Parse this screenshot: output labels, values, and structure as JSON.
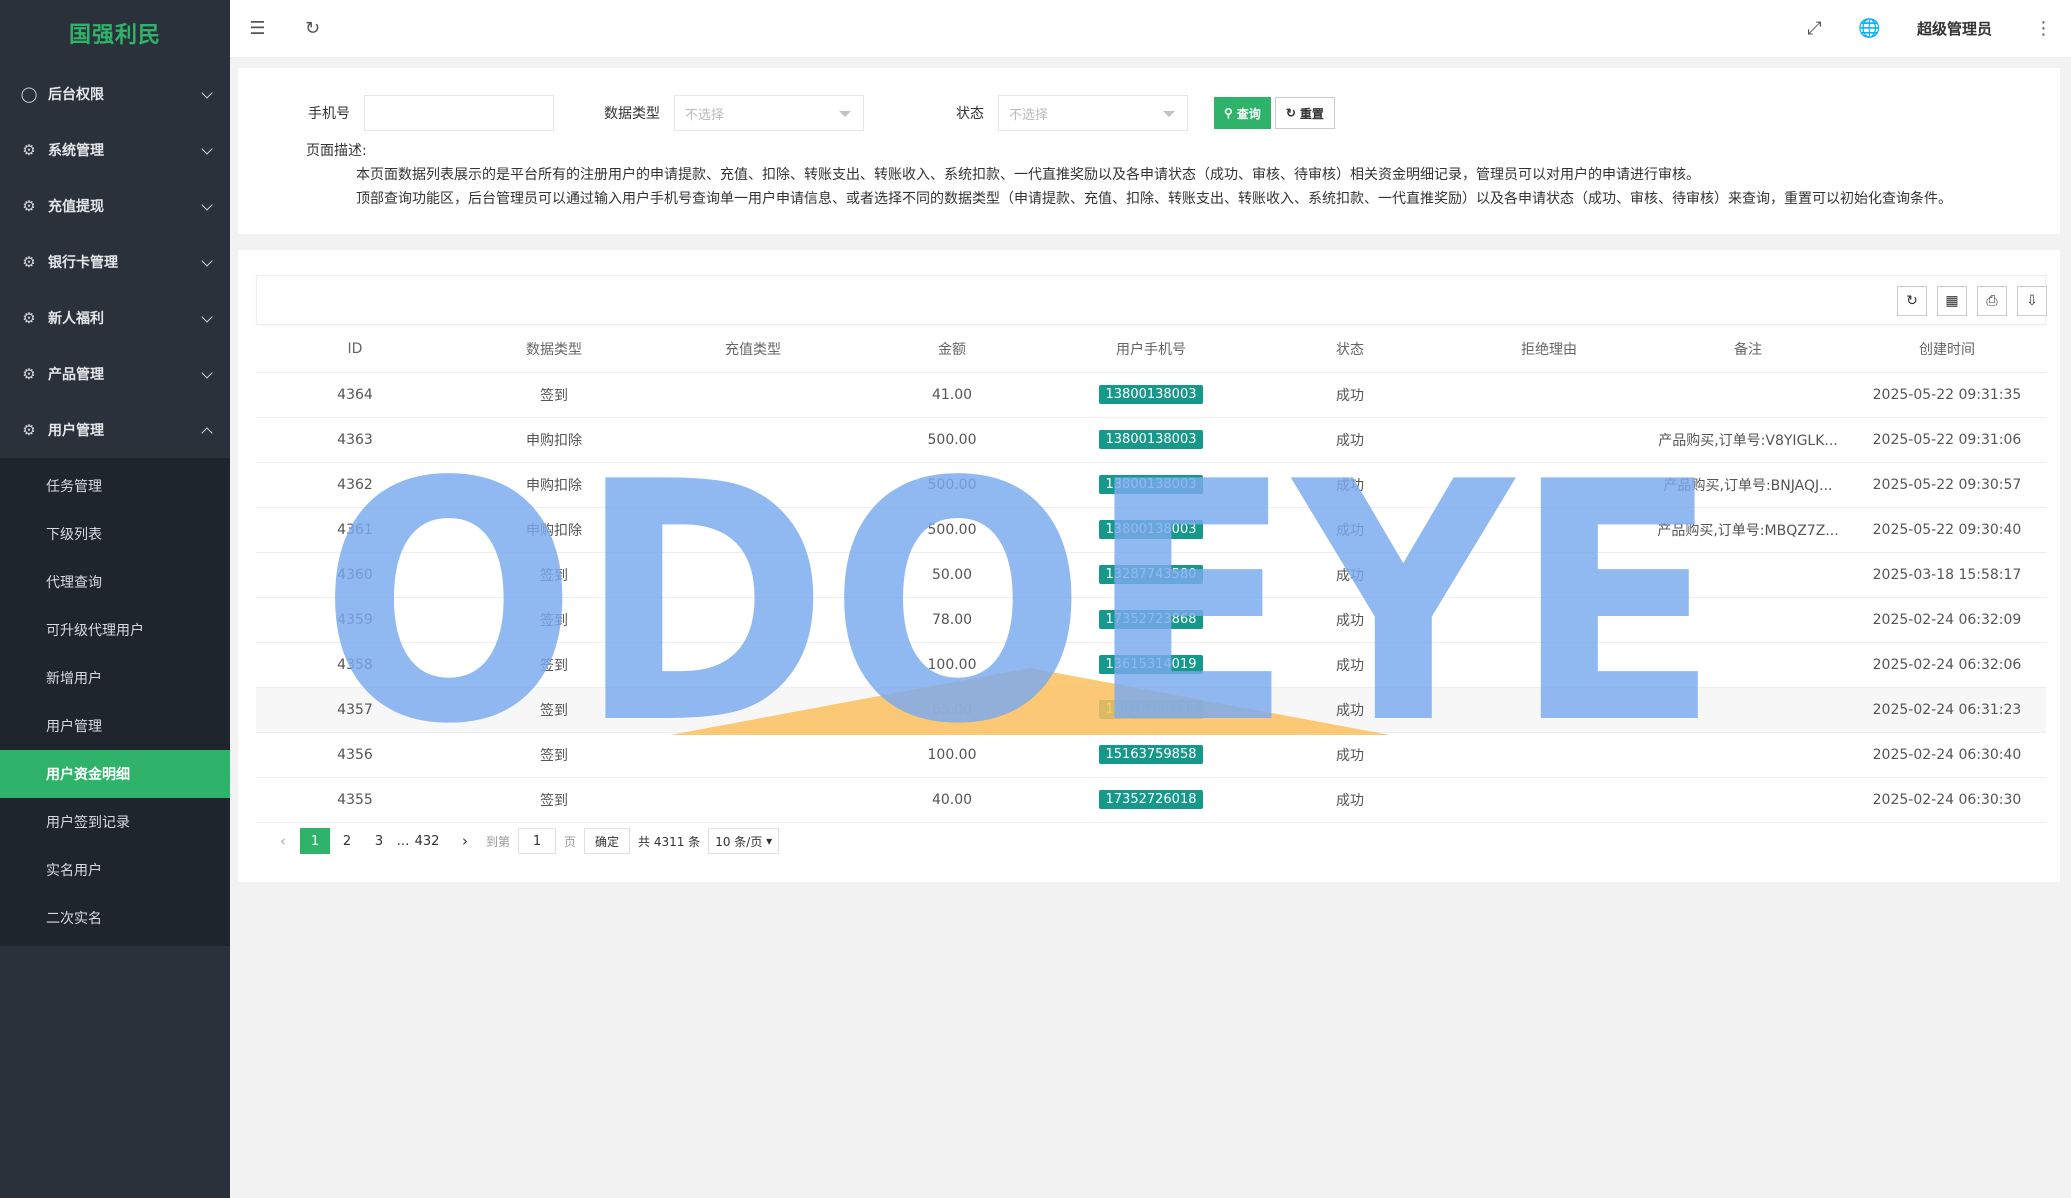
{
  "app": {
    "logo": "国强利民"
  },
  "sidebar": {
    "groups": [
      {
        "label": "后台权限",
        "icon": "user-icon"
      },
      {
        "label": "系统管理",
        "icon": "gear-icon"
      },
      {
        "label": "充值提现",
        "icon": "gear-icon"
      },
      {
        "label": "银行卡管理",
        "icon": "gear-icon"
      },
      {
        "label": "新人福利",
        "icon": "gear-icon"
      },
      {
        "label": "产品管理",
        "icon": "gear-icon"
      },
      {
        "label": "用户管理",
        "icon": "gear-icon"
      }
    ],
    "sub_items": [
      "任务管理",
      "下级列表",
      "代理查询",
      "可升级代理用户",
      "新增用户",
      "用户管理",
      "用户资金明细",
      "用户签到记录",
      "实名用户",
      "二次实名"
    ],
    "active": "用户资金明细"
  },
  "header": {
    "admin": "超级管理员"
  },
  "search": {
    "phone_label": "手机号",
    "type_label": "数据类型",
    "type_placeholder": "不选择",
    "status_label": "状态",
    "status_placeholder": "不选择",
    "query_label": "查询",
    "reset_label": "重置"
  },
  "description": {
    "title": "页面描述:",
    "line1": "本页面数据列表展示的是平台所有的注册用户的申请提款、充值、扣除、转账支出、转账收入、系统扣款、一代直推奖励以及各申请状态（成功、审核、待审核）相关资金明细记录，管理员可以对用户的申请进行审核。",
    "line2": "顶部查询功能区，后台管理员可以通过输入用户手机号查询单一用户申请信息、或者选择不同的数据类型（申请提款、充值、扣除、转账支出、转账收入、系统扣款、一代直推奖励）以及各申请状态（成功、审核、待审核）来查询，重置可以初始化查询条件。"
  },
  "table": {
    "columns": [
      "ID",
      "数据类型",
      "充值类型",
      "金额",
      "用户手机号",
      "状态",
      "拒绝理由",
      "备注",
      "创建时间"
    ],
    "rows": [
      [
        "4364",
        "签到",
        "",
        "41.00",
        "13800138003",
        "成功",
        "",
        "",
        "2025-05-22 09:31:35"
      ],
      [
        "4363",
        "申购扣除",
        "",
        "500.00",
        "13800138003",
        "成功",
        "",
        "产品购买,订单号:V8YIGLK...",
        "2025-05-22 09:31:06"
      ],
      [
        "4362",
        "申购扣除",
        "",
        "500.00",
        "13800138003",
        "成功",
        "",
        "产品购买,订单号:BNJAQJ...",
        "2025-05-22 09:30:57"
      ],
      [
        "4361",
        "申购扣除",
        "",
        "500.00",
        "13800138003",
        "成功",
        "",
        "产品购买,订单号:MBQZ7Z...",
        "2025-05-22 09:30:40"
      ],
      [
        "4360",
        "签到",
        "",
        "50.00",
        "13287743580",
        "成功",
        "",
        "",
        "2025-03-18 15:58:17"
      ],
      [
        "4359",
        "签到",
        "",
        "78.00",
        "17352723868",
        "成功",
        "",
        "",
        "2025-02-24 06:32:09"
      ],
      [
        "4358",
        "签到",
        "",
        "100.00",
        "13615314019",
        "成功",
        "",
        "",
        "2025-02-24 06:32:06"
      ],
      [
        "4357",
        "签到",
        "",
        "65.00",
        "18016268135",
        "成功",
        "",
        "",
        "2025-02-24 06:31:23"
      ],
      [
        "4356",
        "签到",
        "",
        "100.00",
        "15163759858",
        "成功",
        "",
        "",
        "2025-02-24 06:30:40"
      ],
      [
        "4355",
        "签到",
        "",
        "40.00",
        "17352726018",
        "成功",
        "",
        "",
        "2025-02-24 06:30:30"
      ]
    ]
  },
  "pager": {
    "pages": [
      "1",
      "2",
      "3",
      "…",
      "432"
    ],
    "goto_label": "到第",
    "goto_value": "1",
    "page_unit": "页",
    "ok_label": "确定",
    "total": "共 4311 条",
    "size": "10 条/页"
  },
  "watermark": {
    "text": "ODOEYE",
    "color": "#7aaaee",
    "accent": "#fbc15e"
  },
  "colors": {
    "accent": "#2fb36a",
    "phone_badge": "#16998a",
    "sidebar": "#2b313a"
  }
}
